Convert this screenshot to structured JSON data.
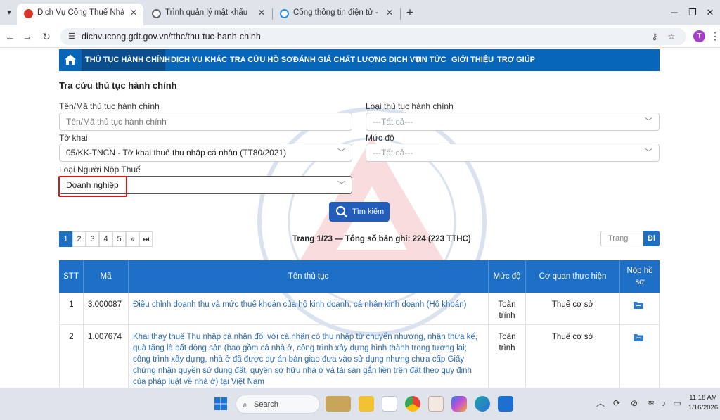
{
  "browser": {
    "tabs": [
      {
        "title": "Dịch Vụ Công Thuế Nhà Nước",
        "active": true
      },
      {
        "title": "Trình quản lý mật khẩu",
        "active": false
      },
      {
        "title": "Cổng thông tin điện tử - Bảo h",
        "active": false
      }
    ],
    "close_glyph": "✕",
    "new_tab_glyph": "+",
    "url": "dichvucong.gdt.gov.vn/tthc/thu-tuc-hanh-chinh",
    "profile_initial": "T"
  },
  "sitenav": {
    "items": [
      "THỦ TỤC HÀNH CHÍNH",
      "DỊCH VỤ KHÁC",
      "TRA CỨU HỒ SƠ",
      "ĐÁNH GIÁ CHẤT LƯỢNG DỊCH VỤ",
      "TIN TỨC",
      "GIỚI THIỆU",
      "TRỢ GIÚP"
    ],
    "active_index": 0
  },
  "form": {
    "heading": "Tra cứu thủ tục hành chính",
    "name_label": "Tên/Mã thủ tục hành chính",
    "name_placeholder": "Tên/Mã thủ tục hành chính",
    "type_label": "Loại thủ tục hành chính",
    "type_value": "---Tất cả---",
    "form_label": "Tờ khai",
    "form_value": "05/KK-TNCN - Tờ khai thuế thu nhập cá nhân (TT80/2021)",
    "level_label": "Mức độ",
    "level_value": "---Tất cả---",
    "payer_label": "Loại Người Nộp Thuế",
    "payer_value": "Doanh nghiệp",
    "search_button": "Tìm kiếm"
  },
  "pager": {
    "pages": [
      "1",
      "2",
      "3",
      "4",
      "5",
      "»",
      "⏭"
    ],
    "active_page": "1",
    "info": "Trang 1/23 — Tổng số bản ghi: 224 (223 TTHC)",
    "goto_placeholder": "Trang",
    "goto_button": "Đi"
  },
  "table": {
    "headers": [
      "STT",
      "Mã",
      "Tên thủ tục",
      "Mức độ",
      "Cơ quan thực hiện",
      "Nộp hồ sơ"
    ],
    "rows": [
      {
        "stt": "1",
        "code": "3.000087",
        "name": "Điều chỉnh doanh thu và mức thuế khoán của hộ kinh doanh, cá nhân kinh doanh (Hộ khoán)",
        "level": "Toàn trình",
        "agency": "Thuế cơ sở"
      },
      {
        "stt": "2",
        "code": "1.007674",
        "name": "Khai thay thuế Thu nhập cá nhân đối với cá nhân có thu nhập từ chuyển nhượng, nhận thừa kế, quà tặng là bất động sản (bao gồm cả nhà ở, công trình xây dựng hình thành trong tương lai; công trình xây dựng, nhà ở đã được dự án bàn giao đưa vào sử dụng nhưng chưa cấp Giấy chứng nhận quyền sử dụng đất, quyền sở hữu nhà ở và tài sản gắn liền trên đất theo quy định của pháp luật về nhà ở) tại Việt Nam",
        "level": "Toàn trình",
        "agency": "Thuế cơ sở"
      }
    ]
  },
  "taskbar": {
    "search_placeholder": "Search",
    "time": "11:18 AM",
    "date": "1/16/2026"
  },
  "colors": {
    "nav_blue": "#0866b8",
    "nav_active": "#0a4e8e",
    "table_header": "#1c6fc4",
    "highlight_red": "#d61a1a",
    "link": "#2b6ab0"
  }
}
